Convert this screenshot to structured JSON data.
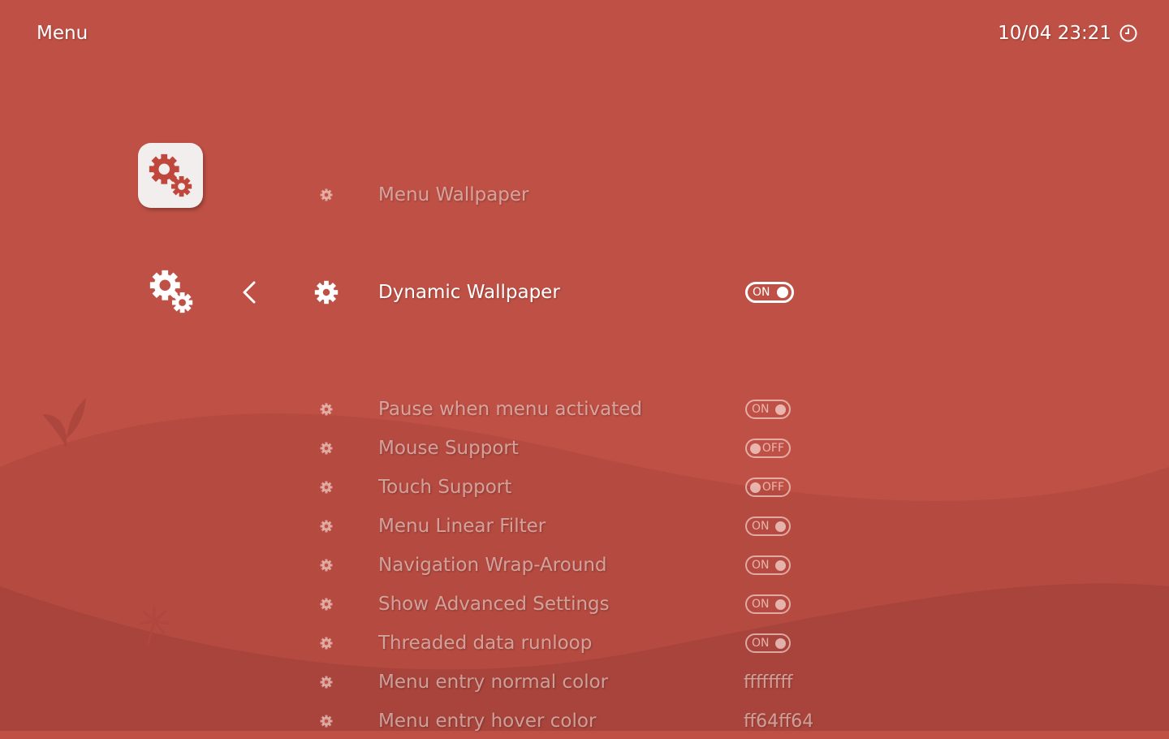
{
  "header": {
    "title": "Menu",
    "datetime": "10/04 23:21"
  },
  "colors": {
    "background": "#bf5045",
    "accent": "#ffffff"
  },
  "sidebar": {
    "icon": "settings-gears-icon",
    "back_icon": "chevron-left-icon"
  },
  "menu": {
    "items": [
      {
        "label": "Menu Wallpaper",
        "value": "",
        "type": "none",
        "active": false
      },
      {
        "label": "Dynamic Wallpaper",
        "value": "ON",
        "type": "toggle",
        "active": true
      },
      {
        "label": "Pause when menu activated",
        "value": "ON",
        "type": "toggle",
        "active": false
      },
      {
        "label": "Mouse Support",
        "value": "OFF",
        "type": "toggle",
        "active": false
      },
      {
        "label": "Touch Support",
        "value": "OFF",
        "type": "toggle",
        "active": false
      },
      {
        "label": "Menu Linear Filter",
        "value": "ON",
        "type": "toggle",
        "active": false
      },
      {
        "label": "Navigation Wrap-Around",
        "value": "ON",
        "type": "toggle",
        "active": false
      },
      {
        "label": "Show Advanced Settings",
        "value": "ON",
        "type": "toggle",
        "active": false
      },
      {
        "label": "Threaded data runloop",
        "value": "ON",
        "type": "toggle",
        "active": false
      },
      {
        "label": "Menu entry normal color",
        "value": "ffffffff",
        "type": "text",
        "active": false
      },
      {
        "label": "Menu entry hover color",
        "value": "ff64ff64",
        "type": "text",
        "active": false
      }
    ]
  }
}
